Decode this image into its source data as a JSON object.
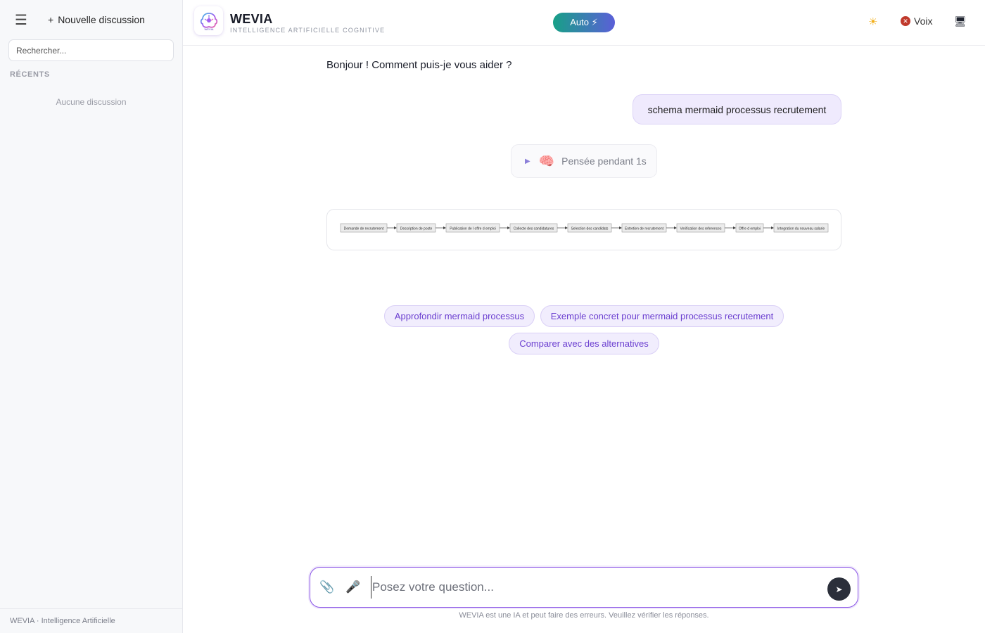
{
  "sidebar": {
    "menu_icon": "hamburger-icon",
    "new_discussion_label": "Nouvelle discussion",
    "search_placeholder": "Rechercher...",
    "recents_heading": "RÉCENTS",
    "empty_text": "Aucune discussion",
    "footer_text": "WEVIA · Intelligence Artificielle"
  },
  "header": {
    "title": "WEVIA",
    "subtitle": "INTELLIGENCE ARTIFICIELLE COGNITIVE",
    "logo_text": "WEVIA",
    "mode_label": "Auto ⚡",
    "theme_icon": "sun-icon",
    "voice_label": "Voix",
    "screen_icon": "monitor-icon"
  },
  "chat": {
    "greeting": "Bonjour ! Comment puis-je vous aider ?",
    "user_message": "schema mermaid processus recrutement",
    "thought_label": "Pensée pendant 1s",
    "diagram_steps": [
      "Demande de recrutement",
      "Description de poste",
      "Publication de l offre d emploi",
      "Collecte des candidatures",
      "Selection des candidats",
      "Entretien de recrutement",
      "Verification des references",
      "Offre d emploi",
      "Integration du nouveau salarie"
    ],
    "suggestions": [
      "Approfondir mermaid processus",
      "Exemple concret pour mermaid processus recrutement",
      "Comparer avec des alternatives"
    ]
  },
  "composer": {
    "placeholder": "Posez votre question...",
    "attach_icon": "paperclip-icon",
    "mic_icon": "microphone-icon",
    "send_icon": "send-icon",
    "disclaimer": "WEVIA est une IA et peut faire des erreurs. Veuillez vérifier les réponses."
  },
  "colors": {
    "accent": "#8a55e6",
    "chip_text": "#6b3fd0",
    "chip_bg": "#f1edfd",
    "user_bubble": "#efeafd"
  }
}
